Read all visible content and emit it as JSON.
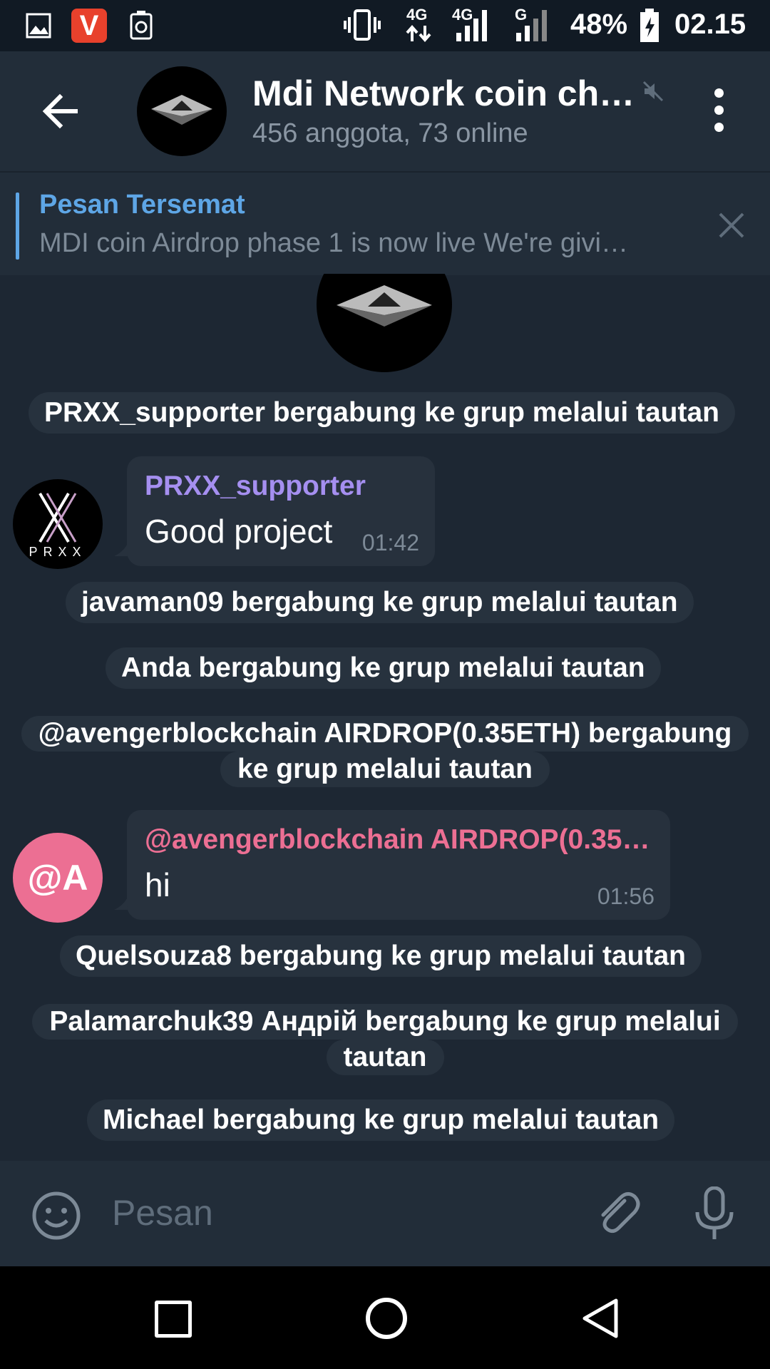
{
  "status_bar": {
    "battery": "48%",
    "time": "02.15",
    "net1": "4G",
    "net2": "4G",
    "net3": "G"
  },
  "header": {
    "title": "Mdi Network coin ch…",
    "subtitle": "456 anggota, 73 online"
  },
  "pinned": {
    "title": "Pesan Tersemat",
    "text": "MDI coin Airdrop phase 1 is now live We're givi…"
  },
  "chat": {
    "service_1": "PRXX_supporter bergabung ke grup melalui tautan",
    "msg_1": {
      "name": "PRXX_supporter",
      "text": "Good project",
      "time": "01:42",
      "avatar_label": "PRXX",
      "name_color": "#a58ff0"
    },
    "service_2": "javaman09 bergabung ke grup melalui tautan",
    "service_3": "Anda bergabung ke grup melalui tautan",
    "service_4_line1": "@avengerblockchain AIRDROP(0.35ETH) bergabung",
    "service_4_line2": "ke grup melalui tautan",
    "msg_2": {
      "name": "@avengerblockchain AIRDROP(0.35…",
      "text": "hi",
      "time": "01:56",
      "avatar_label": "@A",
      "name_color": "#ec6f93"
    },
    "service_5": "Quelsouza8 bergabung ke grup melalui tautan",
    "service_6_line1": "Palamarchuk39 Андрій bergabung ke grup melalui",
    "service_6_line2": "tautan",
    "service_7": "Michael bergabung ke grup melalui tautan"
  },
  "input": {
    "placeholder": "Pesan"
  },
  "icons": {
    "back": "arrow-left-icon",
    "mute": "speaker-muted-icon",
    "menu": "more-vertical-icon",
    "close": "close-icon",
    "emoji": "smiley-icon",
    "attach": "paperclip-icon",
    "mic": "microphone-icon"
  },
  "colors": {
    "background": "#1d2733",
    "header": "#222d39",
    "accent": "#5ea6e6",
    "bubble": "#27313d"
  }
}
